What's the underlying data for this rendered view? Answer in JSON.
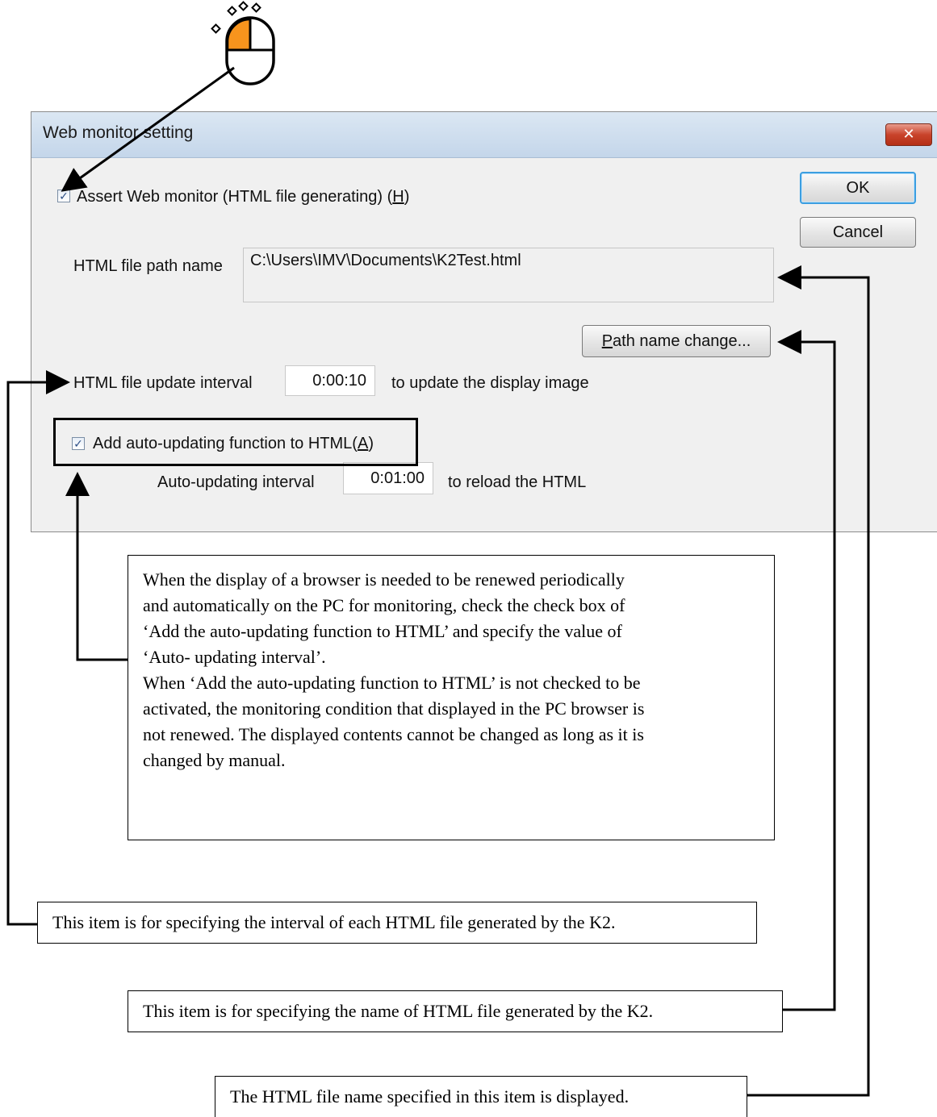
{
  "dialog": {
    "title": "Web monitor setting",
    "close_glyph": "✕",
    "assert_checkbox": {
      "checked": true,
      "label_prefix": "Assert Web monitor (HTML file generating) (",
      "accel": "H",
      "label_suffix": ")"
    },
    "ok_label": "OK",
    "cancel_label": "Cancel",
    "path_label": "HTML file path name",
    "path_value": "C:\\Users\\IMV\\Documents\\K2Test.html",
    "path_button": {
      "accel": "P",
      "rest": "ath name change..."
    },
    "update_interval": {
      "label": "HTML file update interval",
      "value": "0:00:10",
      "suffix": "to update the display image"
    },
    "auto_update_checkbox": {
      "checked": true,
      "label_prefix": "Add auto-updating function to HTML(",
      "accel": "A",
      "label_suffix": ")"
    },
    "auto_interval": {
      "label": "Auto-updating interval",
      "value": "0:01:00",
      "suffix": "to reload the HTML"
    }
  },
  "callouts": {
    "auto_update_note": [
      "When the display of a browser is needed to be renewed periodically",
      "and automatically on the PC for monitoring, check the check box of",
      "‘Add the auto-updating function to HTML’ and specify the value of",
      "‘Auto- updating interval’.",
      "When ‘Add the auto-updating function to HTML’ is not checked to be",
      "activated, the monitoring condition that displayed in the PC browser is",
      "not renewed. The displayed contents cannot be changed as long as it is",
      "changed by manual."
    ],
    "interval_note": "This item is for specifying the interval of each HTML file generated by the K2.",
    "name_note": "This item is for specifying the name of HTML file generated by the K2.",
    "display_note": "The HTML file name specified in this item is displayed."
  },
  "icons": {
    "mouse": "mouse-click-icon",
    "check": "✓"
  },
  "colors": {
    "mouse_button": "#f7941d",
    "ok_focus": "#3c9ee0",
    "close": "#c9432b"
  }
}
